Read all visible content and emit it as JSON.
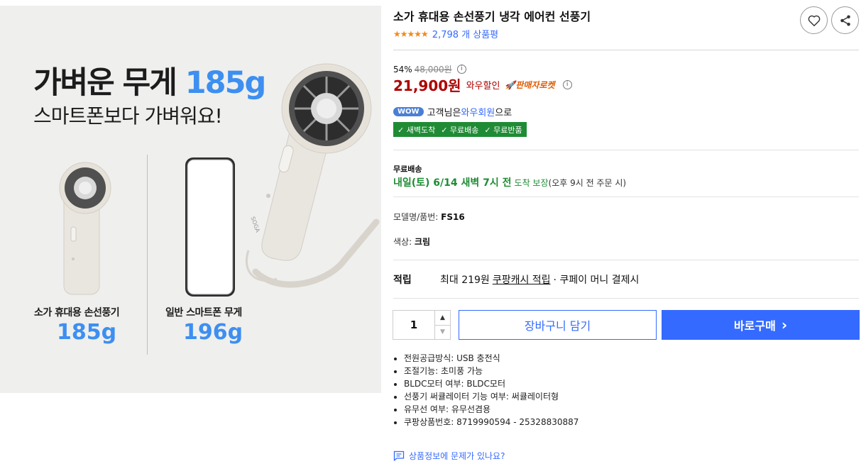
{
  "product_image": {
    "headline_prefix": "가벼운 무게",
    "headline_weight": "185g",
    "subline": "스마트폰보다 가벼워요!",
    "left_caption": "소가 휴대용 손선풍기",
    "left_weight": "185g",
    "right_caption": "일반 스마트폰 무게",
    "right_weight": "196g",
    "fan_brand": "SOGA"
  },
  "header": {
    "title": "소가 휴대용 손선풍기 냉각 에어컨 선풍기",
    "rating_stars": "★★★★★",
    "review_count": "2,798 개 상품평",
    "wishlist_icon": "heart-icon",
    "share_icon": "share-icon"
  },
  "price": {
    "discount_rate": "54%",
    "original_price": "48,000원",
    "sale_price": "21,900원",
    "wow_discount_label": "와우할인",
    "rocket_label": "🚀판매자로켓",
    "info_glyph": "i"
  },
  "wow": {
    "badge": "WOW",
    "prefix": "고객님은",
    "member_link": "와우회원",
    "suffix": "으로",
    "benefits": [
      "✓ 새벽도착",
      "✓ 무료배송",
      "✓ 무료반품"
    ]
  },
  "shipping": {
    "label": "무료배송",
    "date": "내일(토) 6/14 새벽 7시 전",
    "guarantee": "도착 보장",
    "note": "(오후 9시 전 주문 시)"
  },
  "specs": {
    "model_label": "모델명/품번:",
    "model_value": "FS16",
    "color_label": "색상:",
    "color_value": "크림"
  },
  "reward": {
    "label": "적립",
    "max_text": "최대 219원",
    "cash_link": "쿠팡캐시 적립",
    "suffix": "· 쿠페이 머니 결제시"
  },
  "purchase": {
    "quantity": "1",
    "up_arrow": "▲",
    "down_arrow": "▼",
    "cart_label": "장바구니 담기",
    "buy_label": "바로구매",
    "buy_chevron": "›"
  },
  "attributes": [
    "전원공급방식: USB 충전식",
    "조절기능: 초미풍 가능",
    "BLDC모터 여부: BLDC모터",
    "선풍기 써큘레이터 기능 여부: 써큘레이터형",
    "유무선 여부: 유무선겸용",
    "쿠팡상품번호: 8719990594 - 25328830887"
  ],
  "report": {
    "label": "상품정보에 문제가 있나요?"
  },
  "colors": {
    "accent_blue": "#346aff",
    "price_red": "#ae0000",
    "delivery_green": "#1f8c35",
    "image_blue": "#3d8ff0"
  }
}
